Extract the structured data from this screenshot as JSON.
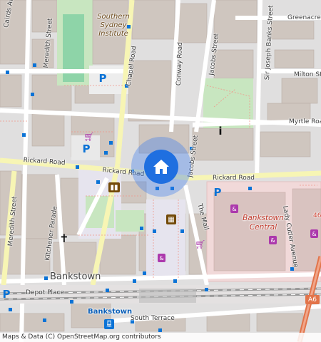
{
  "map": {
    "attribution": "Maps & Data (C) OpenStreetMap.org contributors",
    "colors": {
      "background": "#e0dfdf",
      "road": "#ffffff",
      "road_casing": "#c9c4c0",
      "primary_road": "#fcd6a4",
      "secondary_road": "#f7f5b4",
      "park": "#c8e6c0",
      "pitch": "#8ed4a8",
      "building": "#cfc6bf",
      "building_dark": "#c4b7ae",
      "railway": "#999999",
      "pedestrian": "#e6e4ee",
      "commercial": "#f1d9d9",
      "location": "#1f6fe0",
      "bus_stop": "#0b73d6",
      "parking": "#0b73d6",
      "shop_icon": "#ac39ac",
      "poi_brown": "#734a08"
    },
    "streets": {
      "cairds_ave": "Cairds Ave",
      "meredith_street_top": "Meredith Street",
      "meredith_street_bottom": "Meredith Street",
      "chapel_road": "Chapel Road",
      "conway_road": "Conway Road",
      "jacobs_street_top": "Jacobs Street",
      "jacobs_street_mid": "Jacobs Street",
      "sir_joseph_banks": "Sir Joseph Banks Street",
      "greenacre": "Greenacre",
      "milton_street": "Milton Street",
      "myrtle_road": "Myrtle Road",
      "rickard_road_left": "Rickard Road",
      "rickard_road_mid": "Rickard Road",
      "rickard_road_right": "Rickard Road",
      "kitchener_parade": "Kitchener Parade",
      "the_mall": "The Mall",
      "lady_cutler_avenue": "Lady Cutler Avenue",
      "depot_place": "Depot Place",
      "south_terrace": "South Terrace",
      "route_a6": "A6"
    },
    "places": {
      "southern_sydney_institute": "Southern Sydney Institute",
      "bankstown_central": "Bankstown Central",
      "bankstown_suburb": "Bankstown",
      "bankstown_station": "Bankstown",
      "partial_label": "46"
    },
    "icons": {
      "location": "home-icon",
      "info": "info-icon",
      "library": "library-icon",
      "cinema": "cinema-icon",
      "church": "church-icon",
      "parking": "parking-icon",
      "shop": "shopping-cart-icon",
      "shop_bag": "shopping-bag-icon",
      "bus": "bus-icon",
      "train": "train-icon"
    }
  }
}
